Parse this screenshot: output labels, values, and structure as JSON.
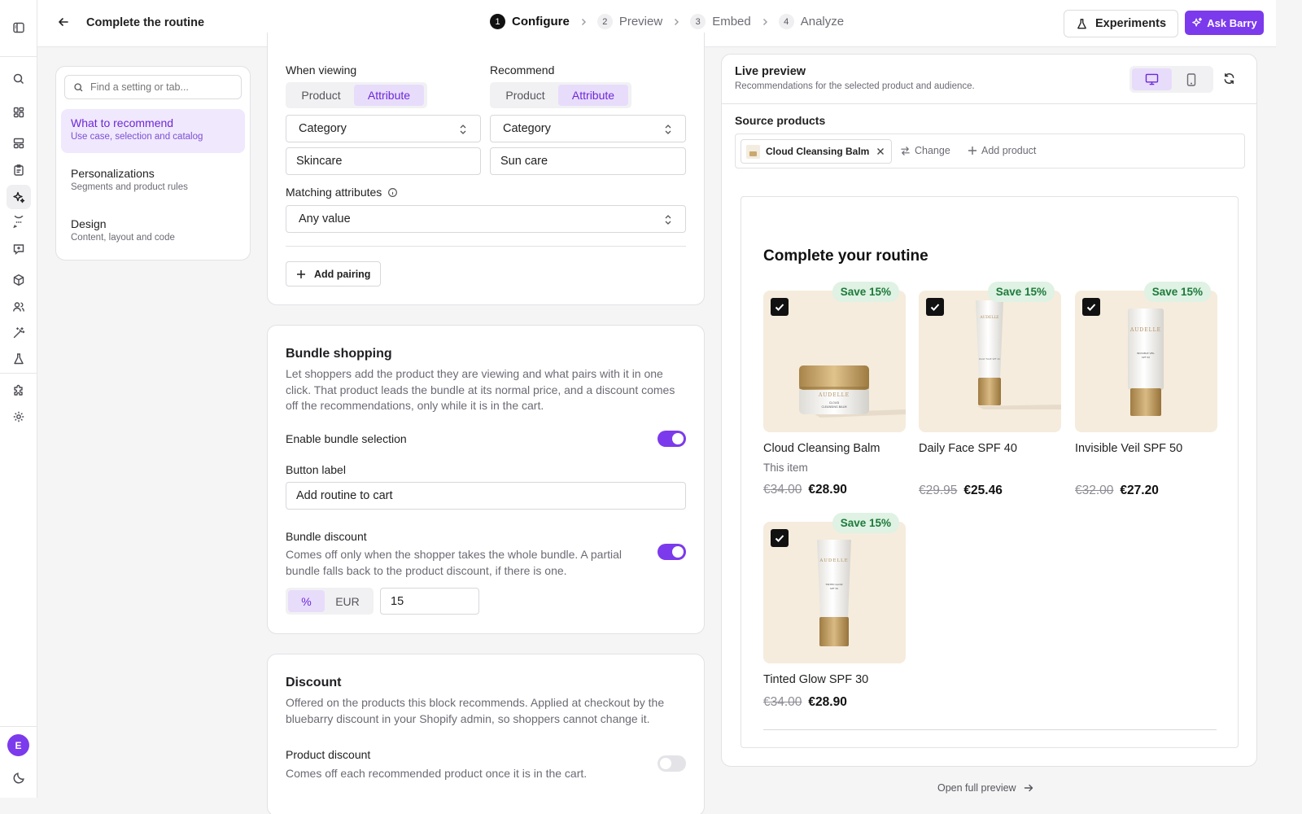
{
  "rail": {
    "icons": [
      "sidebar-toggle-icon",
      "search-icon",
      "dashboard-icon",
      "layout-icon",
      "clipboard-icon",
      "sparkles-icon",
      "chat-icon",
      "message-icon",
      "package-icon",
      "users-icon",
      "wand-icon",
      "flask-icon",
      "puzzle-icon",
      "gear-icon",
      "moon-icon"
    ],
    "avatar_initial": "E"
  },
  "header": {
    "page_title": "Complete the routine",
    "steps": [
      {
        "num": "1",
        "label": "Configure"
      },
      {
        "num": "2",
        "label": "Preview"
      },
      {
        "num": "3",
        "label": "Embed"
      },
      {
        "num": "4",
        "label": "Analyze"
      }
    ],
    "experiments_label": "Experiments",
    "ask_label": "Ask Barry"
  },
  "settings_nav": {
    "search_placeholder": "Find a setting or tab...",
    "items": [
      {
        "title": "What to recommend",
        "subtitle": "Use case, selection and catalog"
      },
      {
        "title": "Personalizations",
        "subtitle": "Segments and product rules"
      },
      {
        "title": "Design",
        "subtitle": "Content, layout and code"
      }
    ]
  },
  "recommend": {
    "when_viewing": {
      "label": "When viewing",
      "options": [
        "Product",
        "Attribute"
      ],
      "selected": "Attribute",
      "attribute": "Category",
      "value": "Skincare"
    },
    "recommend": {
      "label": "Recommend",
      "options": [
        "Product",
        "Attribute"
      ],
      "selected": "Attribute",
      "attribute": "Category",
      "value": "Sun care"
    },
    "matching_label": "Matching attributes",
    "matching_value": "Any value",
    "add_pairing": "Add pairing"
  },
  "bundle": {
    "title": "Bundle shopping",
    "description": "Let shoppers add the product they are viewing and what pairs with it in one click. That product leads the bundle at its normal price, and a discount comes off the recommendations, only while it is in the cart.",
    "enable_label": "Enable bundle selection",
    "enable_on": true,
    "button_label_label": "Button label",
    "button_label_value": "Add routine to cart",
    "discount_label": "Bundle discount",
    "discount_desc": "Comes off only when the shopper takes the whole bundle. A partial bundle falls back to the product discount, if there is one.",
    "discount_on": true,
    "units": [
      "%",
      "EUR"
    ],
    "unit_selected": "%",
    "discount_value": "15"
  },
  "discount": {
    "title": "Discount",
    "description": "Offered on the products this block recommends. Applied at checkout by the bluebarry discount in your Shopify admin, so shoppers cannot change it.",
    "product_discount_label": "Product discount",
    "product_discount_desc": "Comes off each recommended product once it is in the cart.",
    "product_discount_on": false
  },
  "preview": {
    "title": "Live preview",
    "subtitle": "Recommendations for the selected product and audience.",
    "device_selected": "desktop",
    "source_label": "Source products",
    "source_chip": "Cloud Cleansing Balm",
    "change_label": "Change",
    "add_product_label": "Add product",
    "widget_title": "Complete your routine",
    "badge": "Save 15%",
    "products": [
      {
        "name": "Cloud Cleansing Balm",
        "note": "This item",
        "old_price": "€34.00",
        "price": "€28.90",
        "kind": "jar",
        "checked": true
      },
      {
        "name": "Daily Face SPF 40",
        "note": "",
        "old_price": "€29.95",
        "price": "€25.46",
        "kind": "tube",
        "checked": true
      },
      {
        "name": "Invisible Veil SPF 50",
        "note": "",
        "old_price": "€32.00",
        "price": "€27.20",
        "kind": "tube",
        "checked": true
      },
      {
        "name": "Tinted Glow SPF 30",
        "note": "",
        "old_price": "€34.00",
        "price": "€28.90",
        "kind": "tube",
        "checked": true
      }
    ],
    "open_full": "Open full preview"
  },
  "colors": {
    "accent": "#7c3aed",
    "accent_soft": "#e8dcfb",
    "badge_bg": "#dff2e4",
    "badge_text": "#1d7a3a",
    "product_bg": "#f5ecdd"
  }
}
